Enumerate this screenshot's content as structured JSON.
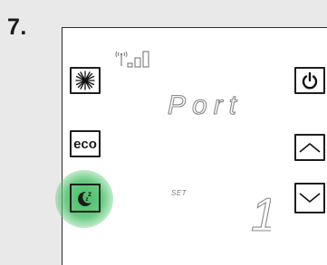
{
  "step": {
    "number": "7."
  },
  "buttons": {
    "fan": {
      "icon": "fan-snowflake-icon"
    },
    "eco": {
      "label": "eco",
      "icon": "eco-text-icon"
    },
    "night": {
      "icon": "night-moon-icon",
      "highlighted": true
    },
    "power": {
      "icon": "power-icon"
    },
    "up": {
      "icon": "chevron-up-icon"
    },
    "down": {
      "icon": "chevron-down-icon"
    }
  },
  "display": {
    "mode_text": "Port",
    "set_label": "SET",
    "set_value": "1",
    "signal": {
      "icon": "wireless-signal-icon"
    }
  },
  "colors": {
    "highlight": "#41b95f",
    "lcd_segment": "#7a7a7a",
    "button_border": "#1e1e1e",
    "background": "#e9e9e9"
  }
}
